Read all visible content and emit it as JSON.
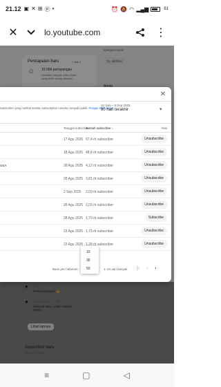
{
  "status": {
    "time": "21.12",
    "battery": "61"
  },
  "browser": {
    "url": "lo.youtube.com"
  },
  "background": {
    "section_title": "Pencapaian baru",
    "pager": "1 dari 2",
    "milestone": "10.000 penayangan",
    "milestone_desc": "Semakin banyak video Anda yang lebih sering ditonton",
    "side_label_1": "kategori musik",
    "side_label_2": "Ya, aktifkan",
    "side_label_3": "Berita"
  },
  "modal": {
    "description": "Subscriber yang melihat setelan subscription mereka menjadi publik.",
    "description_link": "Pelajari lebih lanjut",
    "date_range": "10 Juni – 8 Sep 2025",
    "date_period": "90 hari terakhir",
    "headers": {
      "channel": "",
      "date": "Tanggal subscribe",
      "subs": "Jumlah subscriber",
      "action": "Aksi"
    },
    "rows": [
      {
        "name": "",
        "date": "17 Agu 2025",
        "subs": "57,4 rb subscriber",
        "action": "Unsubscribe"
      },
      {
        "name": "",
        "date": "18 Agu 2025",
        "subs": "48,8 rb subscriber",
        "action": "Unsubscribe"
      },
      {
        "name": "USA",
        "date": "28 Agu 2025",
        "subs": "4,12 rb subscriber",
        "action": "Unsubscribe"
      },
      {
        "name": "",
        "date": "28 Agu 2025",
        "subs": "3,81 rb subscriber",
        "action": "Unsubscribe"
      },
      {
        "name": "",
        "date": "2 Sep 2025",
        "subs": "2,03 rb subscriber",
        "action": "Unsubscribe"
      },
      {
        "name": "",
        "date": "28 Agu 2025",
        "subs": "2,03 rb subscriber",
        "action": "Unsubscribe"
      },
      {
        "name": "",
        "date": "28 Agu 2025",
        "subs": "1,79 rb subscriber",
        "action": "Subscribe"
      },
      {
        "name": "",
        "date": "23 Agu 2025",
        "subs": "1,73 rb subscriber",
        "action": "Unsubscribe"
      },
      {
        "name": "",
        "date": "23 Agu 2025",
        "subs": "1,28 rb subscriber",
        "action": "Unsubscribe"
      }
    ],
    "footer": {
      "perpage_label": "Baris per halaman:",
      "perpage_value": "10",
      "range": "1–10 dari banyak"
    },
    "dropdown_options": [
      "10",
      "30",
      "50"
    ]
  },
  "below": {
    "user_1": "@...",
    "comment_1": "Perfect bangdar 👍",
    "user_2": "@sonymiren... • 11",
    "comment_2": "Selamat sore, salam sukses selalu...",
    "more_button": "Lihat lainnya",
    "section_title": "Subscriber baru",
    "section_sub": "90 hari terakhir"
  }
}
